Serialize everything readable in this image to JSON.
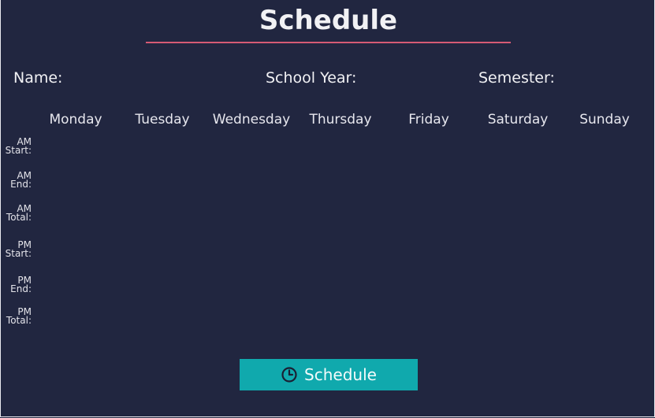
{
  "header": {
    "title": "Schedule"
  },
  "fields": {
    "name_label": "Name:",
    "school_year_label": "School Year:",
    "semester_label": "Semester:"
  },
  "days": [
    "Monday",
    "Tuesday",
    "Wednesday",
    "Thursday",
    "Friday",
    "Saturday",
    "Sunday"
  ],
  "rows": [
    {
      "line1": "AM",
      "line2": "Start:"
    },
    {
      "line1": "AM",
      "line2": "End:"
    },
    {
      "line1": "AM",
      "line2": "Total:"
    },
    {
      "line1": "PM",
      "line2": "Start:"
    },
    {
      "line1": "PM",
      "line2": "End:"
    },
    {
      "line1": "PM",
      "line2": "Total:"
    }
  ],
  "action": {
    "button_label": "Schedule",
    "button_icon": "clock-icon"
  },
  "colors": {
    "background": "#212640",
    "accent_rule": "#d65a74",
    "button": "#10a9ad"
  }
}
